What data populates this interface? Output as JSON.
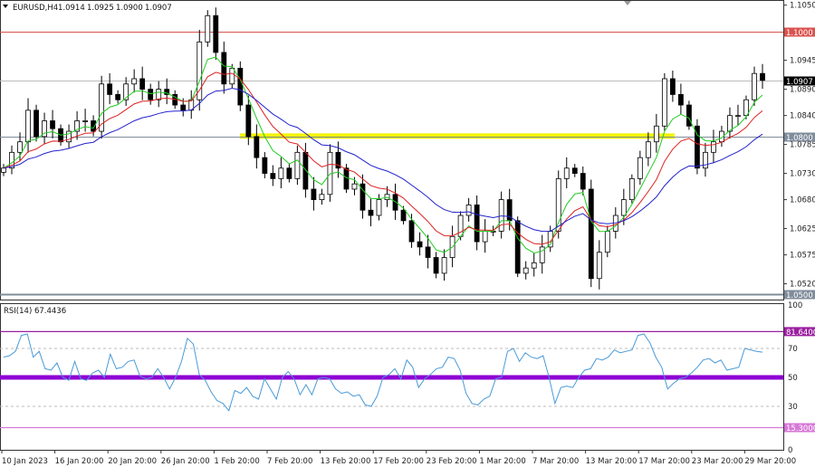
{
  "header": {
    "symbol": "EURUSD,H4",
    "open": "1.0914",
    "high": "1.0925",
    "low": "1.0900",
    "close": "1.0907"
  },
  "price_axis": {
    "ticks": [
      "1.1050",
      "1.0945",
      "1.0890",
      "1.0840",
      "1.0785",
      "1.0730",
      "1.0680",
      "1.0625",
      "1.0575",
      "1.0520"
    ],
    "range": [
      1.049,
      1.1058
    ]
  },
  "levels": [
    {
      "value": 1.1,
      "label": "1.1000",
      "color": "#d9534f"
    },
    {
      "value": 1.0907,
      "label": "1.0907",
      "color": "#000000",
      "line": "#bbbbbb"
    },
    {
      "value": 1.08,
      "label": "1.0800",
      "color": "#7f8c9b"
    },
    {
      "value": 1.05,
      "label": "1.0500",
      "color": "#7f8c9b"
    }
  ],
  "zone": {
    "low": 1.0796,
    "high": 1.0806,
    "color": "#f4f400"
  },
  "ma_colors": [
    "#22cc22",
    "#dd2222",
    "#2222cc"
  ],
  "rsi": {
    "title": "RSI(14) 67.4436",
    "ticks": [
      "100",
      "70",
      "50",
      "30",
      "0"
    ],
    "levels": [
      {
        "value": 81.64,
        "label": "81.6400",
        "color": "#9b1fa0"
      },
      {
        "value": 50,
        "label": "",
        "color": "#8e00d4"
      },
      {
        "value": 15.3,
        "label": "15.3000",
        "color": "#d678d6"
      }
    ],
    "color": "#4a9ad8"
  },
  "time_axis": [
    "10 Jan 2023",
    "16 Jan 20:00",
    "20 Jan 20:00",
    "26 Jan 20:00",
    "1 Feb 20:00",
    "7 Feb 20:00",
    "13 Feb 20:00",
    "17 Feb 20:00",
    "23 Feb 20:00",
    "1 Mar 20:00",
    "7 Mar 20:00",
    "13 Mar 20:00",
    "17 Mar 20:00",
    "23 Mar 20:00",
    "29 Mar 20:00"
  ],
  "chart_data": {
    "type": "candlestick",
    "title": "EURUSD,H4",
    "ylim": [
      1.049,
      1.1058
    ],
    "closes": [
      1.074,
      1.077,
      1.079,
      1.085,
      1.08,
      1.083,
      1.0815,
      1.079,
      1.081,
      1.083,
      1.083,
      1.081,
      1.09,
      1.088,
      1.087,
      1.09,
      1.091,
      1.089,
      1.087,
      1.089,
      1.088,
      1.086,
      1.085,
      1.087,
      1.098,
      1.103,
      1.096,
      1.09,
      1.093,
      1.086,
      1.08,
      1.076,
      1.073,
      1.072,
      1.074,
      1.072,
      1.077,
      1.07,
      1.068,
      1.069,
      1.077,
      1.074,
      1.07,
      1.071,
      1.066,
      1.065,
      1.068,
      1.069,
      1.066,
      1.064,
      1.06,
      1.059,
      1.057,
      1.054,
      1.057,
      1.061,
      1.065,
      1.067,
      1.06,
      1.062,
      1.062,
      1.068,
      1.064,
      1.054,
      1.055,
      1.056,
      1.059,
      1.062,
      1.072,
      1.074,
      1.073,
      1.07,
      1.053,
      1.058,
      1.062,
      1.065,
      1.068,
      1.072,
      1.076,
      1.079,
      1.082,
      1.091,
      1.088,
      1.086,
      1.082,
      1.074,
      1.077,
      1.079,
      1.081,
      1.084,
      1.084,
      1.087,
      1.092,
      1.0907
    ],
    "rsi_values": [
      64,
      65,
      68,
      79,
      80,
      64,
      68,
      56,
      55,
      60,
      50,
      48,
      61,
      49,
      48,
      53,
      55,
      50,
      66,
      56,
      57,
      61,
      62,
      51,
      49,
      50,
      56,
      50,
      42,
      50,
      61,
      77,
      73,
      52,
      48,
      40,
      34,
      32,
      27,
      41,
      39,
      43,
      37,
      35,
      49,
      42,
      35,
      50,
      54,
      49,
      38,
      45,
      38,
      49,
      50,
      49,
      42,
      39,
      40,
      37,
      38,
      31,
      30,
      37,
      50,
      52,
      56,
      49,
      62,
      57,
      43,
      49,
      52,
      56,
      57,
      64,
      63,
      55,
      39,
      32,
      31,
      35,
      37,
      49,
      50,
      68,
      70,
      61,
      67,
      64,
      63,
      65,
      50,
      32,
      43,
      44,
      43,
      50,
      55,
      56,
      63,
      62,
      64,
      69,
      67,
      68,
      69,
      79,
      80,
      74,
      64,
      57,
      42,
      46,
      49,
      50,
      53,
      57,
      62,
      63,
      60,
      62,
      55,
      56,
      57,
      70,
      69,
      68,
      67.4
    ]
  }
}
